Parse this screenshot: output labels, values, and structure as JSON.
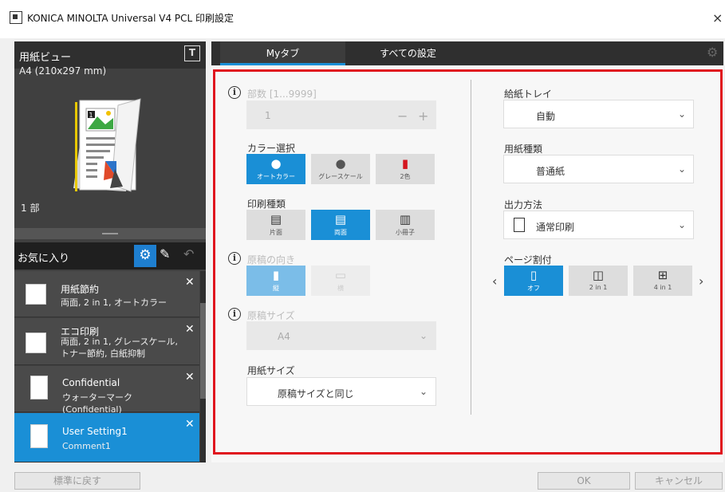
{
  "window": {
    "title": "KONICA MINOLTA Universal V4 PCL 印刷設定",
    "close_icon": "close-icon"
  },
  "paper_view": {
    "title": "用紙ビュー",
    "size": "A4 (210x297 mm)",
    "copies": "1 部"
  },
  "favorites": {
    "title": "お気に入り",
    "items": [
      {
        "name": "用紙節約",
        "desc": "両面, 2 in 1, オートカラー",
        "selected": false
      },
      {
        "name": "エコ印刷",
        "desc": "両面, 2 in 1, グレースケール, トナー節約, 白紙抑制",
        "selected": false
      },
      {
        "name": "Confidential",
        "desc": "ウォーターマーク (Confidential)",
        "selected": false
      },
      {
        "name": "User Setting1",
        "desc": "Comment1",
        "selected": true
      }
    ]
  },
  "tabs": [
    {
      "label": "Myタブ",
      "active": true
    },
    {
      "label": "すべての設定",
      "active": false
    }
  ],
  "left_column": {
    "copies_label": "部数 [1...9999]",
    "copies_value": "1",
    "copies_minus": "−",
    "copies_plus": "+",
    "color_label": "カラー選択",
    "color_options": [
      "オートカラー",
      "グレースケール",
      "2色"
    ],
    "print_type_label": "印刷種類",
    "print_type_options": [
      "片面",
      "両面",
      "小冊子"
    ],
    "orientation_label": "原稿の向き",
    "orientation_options": [
      "縦",
      "横"
    ],
    "orig_size_label": "原稿サイズ",
    "orig_size_value": "A4",
    "paper_size_label": "用紙サイズ",
    "paper_size_value": "原稿サイズと同じ"
  },
  "right_column": {
    "tray_label": "給紙トレイ",
    "tray_value": "自動",
    "paper_type_label": "用紙種類",
    "paper_type_value": "普通紙",
    "output_label": "出力方法",
    "output_value": "通常印刷",
    "nup_label": "ページ割付",
    "nup_options": [
      "オフ",
      "2 in 1",
      "4 in 1"
    ]
  },
  "buttons": {
    "reset": "標準に戻す",
    "ok": "OK",
    "cancel": "キャンセル"
  },
  "colors": {
    "accent": "#1a8fd6",
    "highlight_border": "#e0141e",
    "panel_dark": "#404040"
  }
}
